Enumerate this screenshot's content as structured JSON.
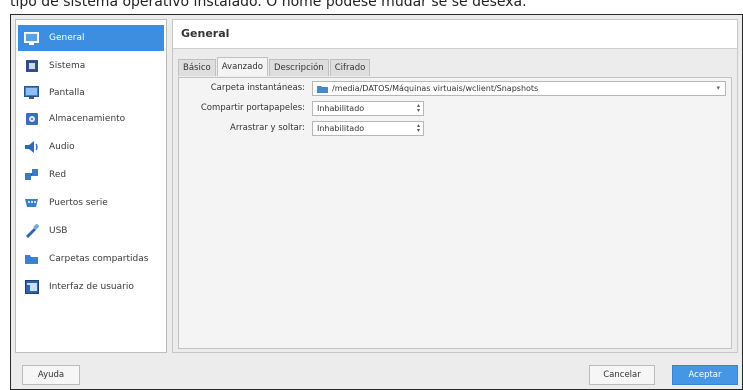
{
  "page_caption": "tipo de sistema operativo instalado. O nome podese mudar se se desexa.",
  "sidebar": {
    "items": [
      {
        "label": "General",
        "icon": "general-icon"
      },
      {
        "label": "Sistema",
        "icon": "chip-icon"
      },
      {
        "label": "Pantalla",
        "icon": "monitor-icon"
      },
      {
        "label": "Almacenamiento",
        "icon": "storage-icon"
      },
      {
        "label": "Audio",
        "icon": "speaker-icon"
      },
      {
        "label": "Red",
        "icon": "network-icon"
      },
      {
        "label": "Puertos serie",
        "icon": "serial-port-icon"
      },
      {
        "label": "USB",
        "icon": "usb-icon"
      },
      {
        "label": "Carpetas compartidas",
        "icon": "folder-icon"
      },
      {
        "label": "Interfaz de usuario",
        "icon": "ui-icon"
      }
    ],
    "selected": "General",
    "accent_color": "#3d8ee0"
  },
  "header": {
    "title": "General"
  },
  "tabs": [
    "Básico",
    "Avanzado",
    "Descripción",
    "Cifrado"
  ],
  "active_tab": "Avanzado",
  "form": {
    "snapshot_label": "Carpeta instantáneas:",
    "snapshot_value": "/media/DATOS/Máquinas virtuais/wclient/Snapshots",
    "clipboard_label": "Compartir portapapeles:",
    "clipboard_value": "Inhabilitado",
    "dragdrop_label": "Arrastrar y soltar:",
    "dragdrop_value": "Inhabilitado"
  },
  "buttons": {
    "help": "Ayuda",
    "cancel": "Cancelar",
    "accept": "Aceptar"
  }
}
